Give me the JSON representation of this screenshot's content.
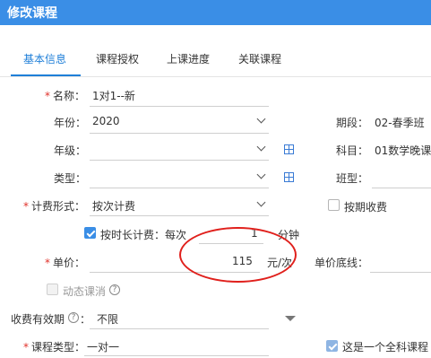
{
  "window": {
    "title": "修改课程"
  },
  "tabs": [
    {
      "label": "基本信息"
    },
    {
      "label": "课程授权"
    },
    {
      "label": "上课进度"
    },
    {
      "label": "关联课程"
    }
  ],
  "form": {
    "name": {
      "label": "名称：",
      "value": "1对1--新"
    },
    "year": {
      "label": "年份：",
      "value": "2020"
    },
    "period": {
      "label": "期段：",
      "value": "02-春季班"
    },
    "grade": {
      "label": "年级：",
      "value": ""
    },
    "subject": {
      "label": "科目：",
      "value": "01数学晚课"
    },
    "type": {
      "label": "类型：",
      "value": ""
    },
    "class_type": {
      "label": "班型：",
      "value": ""
    },
    "billing_form": {
      "label": "计费形式：",
      "value": "按次计费"
    },
    "period_billing": {
      "label": "按期收费",
      "checked": false
    },
    "duration_billing": {
      "label": "按时长计费：每次",
      "checked": true,
      "amount": "1",
      "unit": "分钟"
    },
    "unit_price": {
      "label": "单价：",
      "value": "115",
      "unit": "元/次"
    },
    "price_floor": {
      "label": "单价底线：",
      "value": ""
    },
    "dynamic_consume": {
      "label": "动态课消",
      "checked": false,
      "help": "?"
    },
    "validity": {
      "label": "收费有效期",
      "help": "?",
      "colon": "：",
      "value": "不限"
    },
    "course_type": {
      "label": "课程类型：",
      "value": "一对一"
    },
    "all_subjects": {
      "label": "这是一个全科课程",
      "checked": true
    }
  },
  "required_mark": "*"
}
